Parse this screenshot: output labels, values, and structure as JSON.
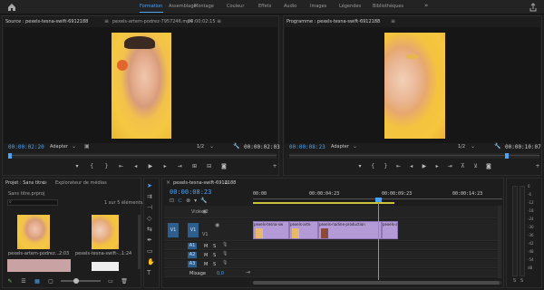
{
  "topbar": {
    "workspaces": [
      "Formation",
      "Assemblage",
      "Montage",
      "Couleur",
      "Effets",
      "Audio",
      "Images",
      "Légendes",
      "Bibliothèques"
    ],
    "active": "Formation",
    "more_label": "»"
  },
  "source": {
    "title": "Source : pexels-tesna-swift-6912188",
    "tab2": "pexels-artem-podrez-7957246.mp4",
    "tab2_time": "00:00:02:15",
    "timecode": "00:00:02:20",
    "fit_label": "Adapter",
    "resolution": "1/2",
    "duration": "00:00:02:03"
  },
  "program": {
    "title": "Programme : pexels-tesna-swift-6912188",
    "timecode": "00:00:08:23",
    "fit_label": "Adapter",
    "resolution": "1/2",
    "duration": "00:00:10:07"
  },
  "project": {
    "tab1": "Projet : Sans titre",
    "tab2": "Explorateur de médias",
    "breadcrumb": "Sans titre.prproj",
    "item_count": "1 sur 5 éléments...",
    "items": [
      {
        "name": "pexels-artem-podrez...",
        "duration": "2:03"
      },
      {
        "name": "pexels-tesna-swift-...",
        "duration": "1:24"
      }
    ]
  },
  "timeline": {
    "tab_title": "pexels-tesna-swift-6912188",
    "timecode": "00:00:08:23",
    "ruler": [
      "00:00",
      "00:00:04:23",
      "00:00:09:23",
      "00:00:14:23"
    ],
    "playhead_fraction": 0.5,
    "tracks": {
      "v2": "Vidéo 2",
      "v1": "V1",
      "src_v1": "V1",
      "a1": "A1",
      "a2": "A2",
      "a3": "A3",
      "mixage": "Mixage",
      "mix_value": "0,0",
      "m": "M",
      "s": "S"
    },
    "clips": [
      "pexels-tesna-sw",
      "pexels-arte",
      "pexels-nadine-production",
      "pexels-a"
    ]
  },
  "meter": {
    "scale": [
      "0",
      "-6",
      "-12",
      "-18",
      "-24",
      "-30",
      "-36",
      "-42",
      "-48",
      "-54",
      "dB"
    ],
    "s_label": "S",
    "s_label2": "S"
  },
  "colors": {
    "accent": "#4ba3f2",
    "clip": "#b49ad6",
    "track_toggle": "#2d5e8e"
  }
}
